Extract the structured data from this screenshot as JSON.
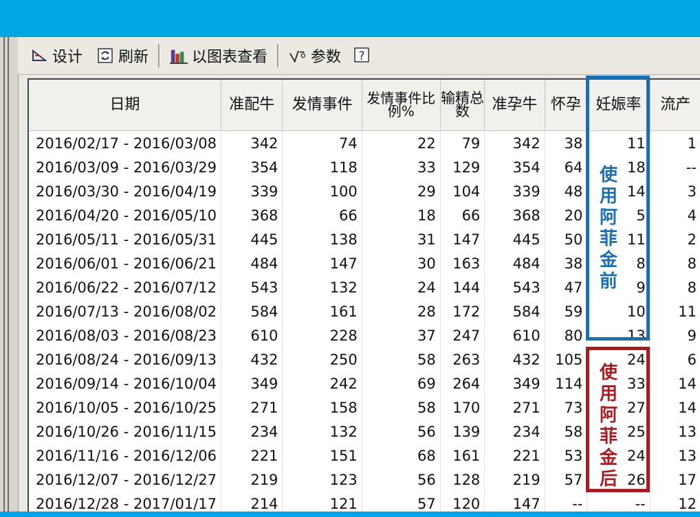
{
  "toolbar": {
    "design_label": "设计",
    "refresh_label": "刷新",
    "chart_view_label": "以图表查看",
    "params_label": "参数",
    "help_icon": "question-icon"
  },
  "table": {
    "columns": [
      "日期",
      "准配牛",
      "发情事件",
      "发情事件比例%",
      "输精总数",
      "准孕牛",
      "怀孕",
      "妊娠率",
      "流产"
    ],
    "rows": [
      [
        "2016/02/17 - 2016/03/08",
        "342",
        "74",
        "22",
        "79",
        "342",
        "38",
        "11",
        "1"
      ],
      [
        "2016/03/09 - 2016/03/29",
        "354",
        "118",
        "33",
        "129",
        "354",
        "64",
        "18",
        "--"
      ],
      [
        "2016/03/30 - 2016/04/19",
        "339",
        "100",
        "29",
        "104",
        "339",
        "48",
        "14",
        "3"
      ],
      [
        "2016/04/20 - 2016/05/10",
        "368",
        "66",
        "18",
        "66",
        "368",
        "20",
        "5",
        "4"
      ],
      [
        "2016/05/11 - 2016/05/31",
        "445",
        "138",
        "31",
        "147",
        "445",
        "50",
        "11",
        "2"
      ],
      [
        "2016/06/01 - 2016/06/21",
        "484",
        "147",
        "30",
        "163",
        "484",
        "38",
        "8",
        "8"
      ],
      [
        "2016/06/22 - 2016/07/12",
        "543",
        "132",
        "24",
        "144",
        "543",
        "47",
        "9",
        "8"
      ],
      [
        "2016/07/13 - 2016/08/02",
        "584",
        "161",
        "28",
        "172",
        "584",
        "59",
        "10",
        "11"
      ],
      [
        "2016/08/03 - 2016/08/23",
        "610",
        "228",
        "37",
        "247",
        "610",
        "80",
        "13",
        "9"
      ],
      [
        "2016/08/24 - 2016/09/13",
        "432",
        "250",
        "58",
        "263",
        "432",
        "105",
        "24",
        "6"
      ],
      [
        "2016/09/14 - 2016/10/04",
        "349",
        "242",
        "69",
        "264",
        "349",
        "114",
        "33",
        "14"
      ],
      [
        "2016/10/05 - 2016/10/25",
        "271",
        "158",
        "58",
        "170",
        "271",
        "73",
        "27",
        "14"
      ],
      [
        "2016/10/26 - 2016/11/15",
        "234",
        "132",
        "56",
        "139",
        "234",
        "58",
        "25",
        "13"
      ],
      [
        "2016/11/16 - 2016/12/06",
        "221",
        "151",
        "68",
        "161",
        "221",
        "53",
        "24",
        "13"
      ],
      [
        "2016/12/07 - 2016/12/27",
        "219",
        "123",
        "56",
        "128",
        "219",
        "57",
        "26",
        "17"
      ],
      [
        "2016/12/28 - 2017/01/17",
        "214",
        "121",
        "57",
        "120",
        "147",
        "--",
        "--",
        "12"
      ]
    ]
  },
  "annotations": {
    "before": {
      "text": "使用阿菲金前",
      "color": "#1c6fae"
    },
    "after": {
      "text": "使用阿菲金后",
      "color": "#a51d22"
    }
  }
}
